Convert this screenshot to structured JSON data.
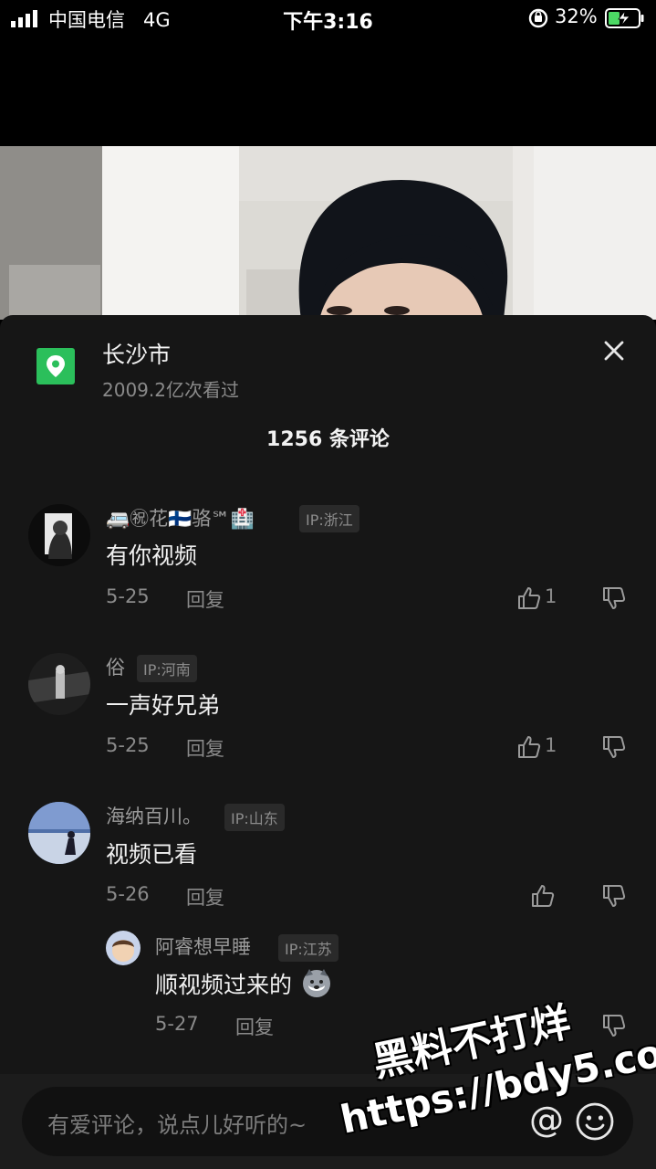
{
  "status_bar": {
    "carrier": "中国电信",
    "network": "4G",
    "time": "下午3:16",
    "battery": "32%"
  },
  "location": {
    "title": "长沙市",
    "views": "2009.2亿次看过"
  },
  "comment_count": "1256 条评论",
  "comments": [
    {
      "username": "🚐㊗花🇫🇮骆℠🏥",
      "ip": "IP:浙江",
      "text": "有你视频",
      "date": "5-25",
      "reply": "回复",
      "likes": "1"
    },
    {
      "username": "俗",
      "ip": "IP:河南",
      "text": "一声好兄弟",
      "date": "5-25",
      "reply": "回复",
      "likes": "1"
    },
    {
      "username": "海纳百川。",
      "ip": "IP:山东",
      "text": "视频已看",
      "date": "5-26",
      "reply": "回复",
      "likes": ""
    },
    {
      "username": "阿睿想早睡",
      "ip": "IP:江苏",
      "text": "顺视频过来的",
      "date": "5-27",
      "reply": "回复",
      "likes": ""
    }
  ],
  "input": {
    "placeholder": "有爱评论，说点儿好听的~",
    "at_symbol": "@"
  },
  "watermark": {
    "line1": "黑料不打烊",
    "line2": "https://bdy5.co"
  },
  "icons": {
    "location": "map-pin-icon",
    "close": "close-icon",
    "like": "thumbs-up-icon",
    "dislike": "thumbs-down-icon",
    "emoji": "smiley-icon"
  },
  "colors": {
    "sheet_bg": "#161616",
    "location_green": "#2bbf5b"
  }
}
